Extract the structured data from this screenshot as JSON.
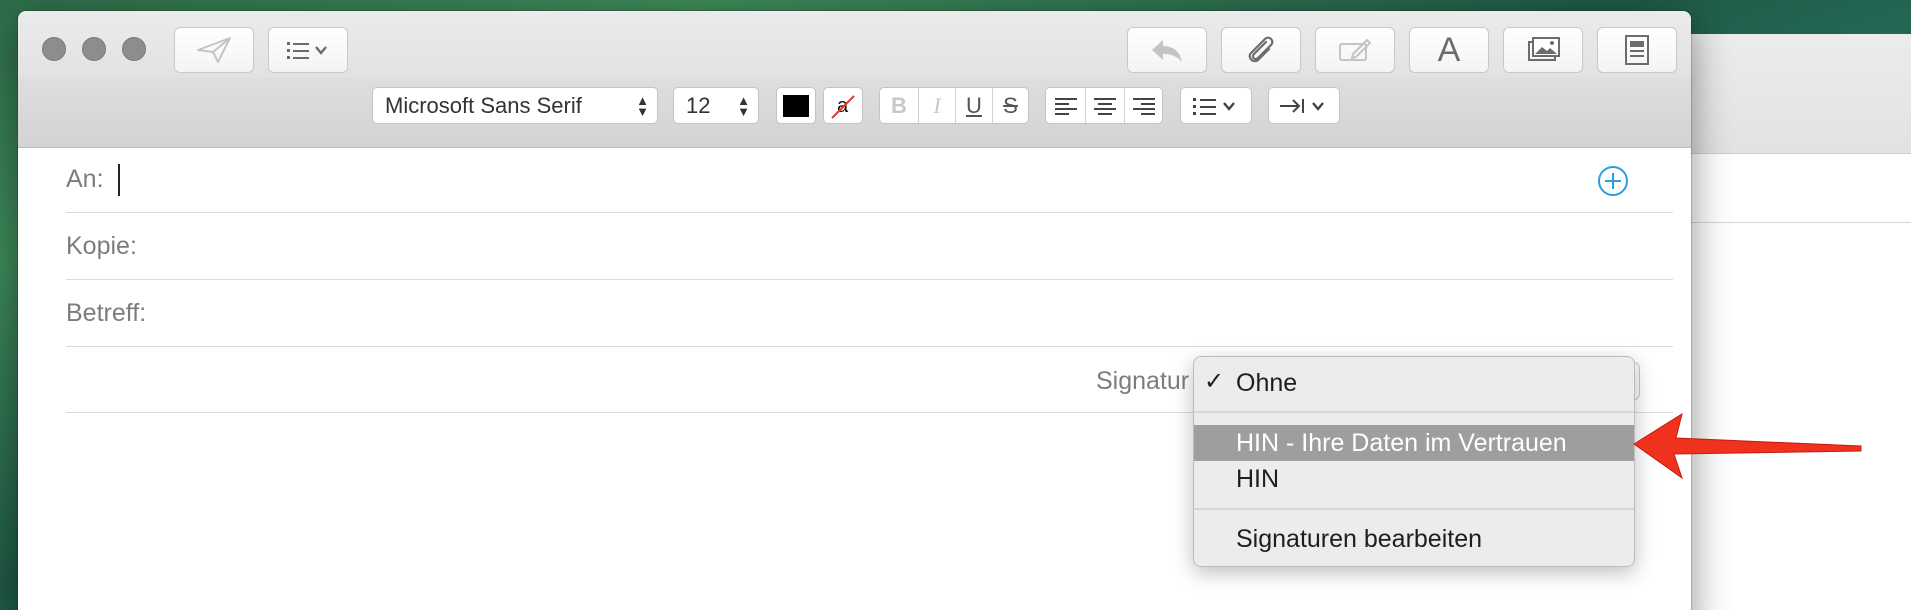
{
  "compose": {
    "fields": {
      "to_label": "An:",
      "cc_label": "Kopie:",
      "subject_label": "Betreff:"
    },
    "signature_label": "Signatur"
  },
  "format_bar": {
    "font_name": "Microsoft Sans Serif",
    "font_size": "12",
    "bold": "B",
    "italic": "I",
    "underline": "U",
    "strike": "S",
    "bg_color_glyph": "a"
  },
  "signature_menu": {
    "items": [
      {
        "label": "Ohne",
        "checked": true
      },
      {
        "label": "HIN - Ihre Daten im Vertrauen",
        "highlighted": true
      },
      {
        "label": "HIN"
      },
      {
        "label": "Signaturen bearbeiten"
      }
    ]
  },
  "colors": {
    "highlight": "#9e9e9e",
    "accent_blue": "#2a9ee0",
    "arrow_red": "#f0311e"
  },
  "icons": [
    "send-icon",
    "list-icon",
    "reply-icon",
    "paperclip-icon",
    "markup-icon",
    "font-icon",
    "photo-icon",
    "stationery-icon",
    "add-contact-icon"
  ]
}
